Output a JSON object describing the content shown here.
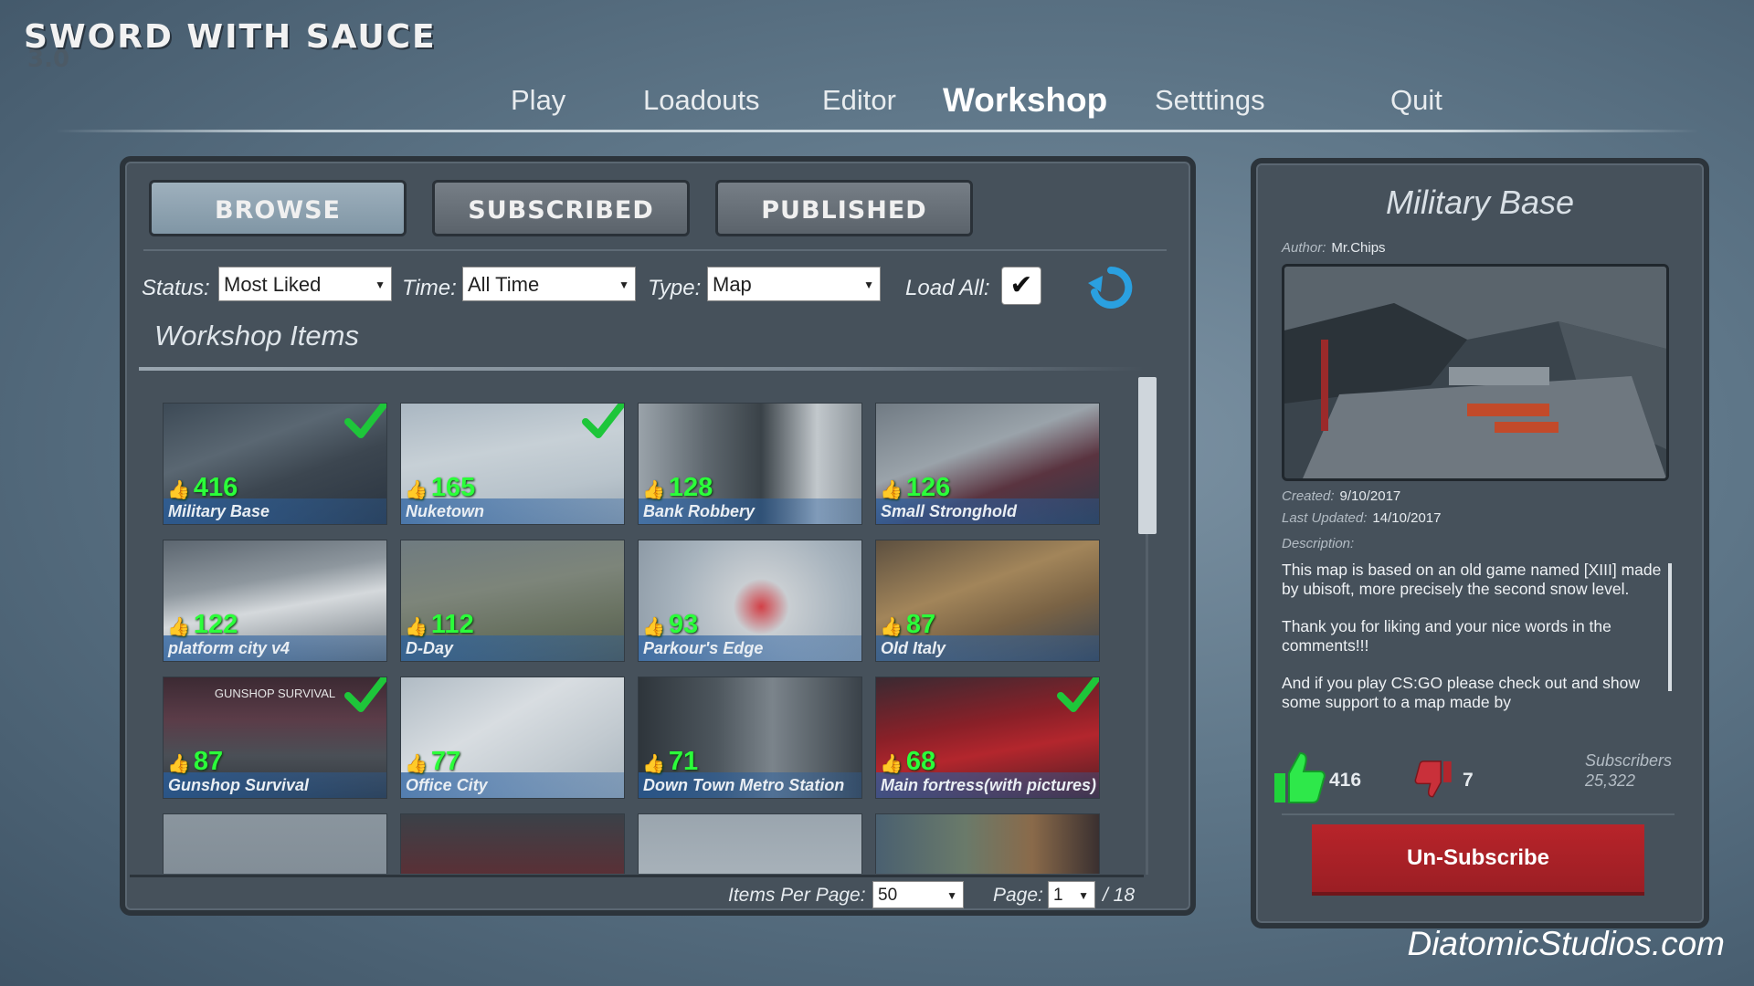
{
  "game": {
    "title": "SWORD WITH SAUCE",
    "version": "3.0"
  },
  "nav": {
    "items": [
      "Play",
      "Loadouts",
      "Editor",
      "Workshop",
      "Setttings",
      "Quit"
    ],
    "active": "Workshop"
  },
  "tabs": {
    "browse": "BROWSE",
    "subscribed": "SUBSCRIBED",
    "published": "PUBLISHED",
    "active": "BROWSE"
  },
  "filters": {
    "status_label": "Status:",
    "status_value": "Most Liked",
    "time_label": "Time:",
    "time_value": "All Time",
    "type_label": "Type:",
    "type_value": "Map",
    "load_all_label": "Load All:",
    "load_all_checked": true,
    "refresh_icon": "refresh-icon"
  },
  "workshop": {
    "title": "Workshop Items",
    "items": [
      {
        "name": "Military Base",
        "likes": "416",
        "subscribed": true
      },
      {
        "name": "Nuketown",
        "likes": "165",
        "subscribed": true
      },
      {
        "name": "Bank Robbery",
        "likes": "128",
        "subscribed": false
      },
      {
        "name": "Small Stronghold",
        "likes": "126",
        "subscribed": false
      },
      {
        "name": "platform city v4",
        "likes": "122",
        "subscribed": false
      },
      {
        "name": "D-Day",
        "likes": "112",
        "subscribed": false
      },
      {
        "name": "Parkour's Edge",
        "likes": "93",
        "subscribed": false
      },
      {
        "name": "Old Italy",
        "likes": "87",
        "subscribed": false
      },
      {
        "name": "Gunshop Survival",
        "likes": "87",
        "subscribed": true,
        "banner": "GUNSHOP SURVIVAL"
      },
      {
        "name": "Office City",
        "likes": "77",
        "subscribed": false
      },
      {
        "name": "Down Town Metro Station",
        "likes": "71",
        "subscribed": false
      },
      {
        "name": "Main fortress(with pictures)",
        "likes": "68",
        "subscribed": true
      }
    ],
    "like_icon": "thumbs-up-icon",
    "subscribed_icon": "checkmark-icon"
  },
  "pager": {
    "items_per_page_label": "Items Per Page:",
    "items_per_page": "50",
    "page_label": "Page:",
    "page": "1",
    "total_pages": "/ 18"
  },
  "detail": {
    "title": "Military Base",
    "author_label": "Author:",
    "author": "Mr.Chips",
    "created_label": "Created:",
    "created": "9/10/2017",
    "updated_label": "Last Updated:",
    "updated": "14/10/2017",
    "description_label": "Description:",
    "description": [
      "This map is based on an old game named [XIII] made by ubisoft, more precisely the second snow level.",
      "Thank you for liking and your nice words in the comments!!!",
      "And if you play CS:GO please check out and show some support to a map made by"
    ],
    "likes": "416",
    "dislikes": "7",
    "subscribers_label": "Subscribers",
    "subscribers": "25,322",
    "unsubscribe_label": "Un-Subscribe"
  },
  "footer": "DiatomicStudios.com",
  "colors": {
    "like_green": "#2bff3a",
    "unsubscribe_red": "#b8242a",
    "active_tab": "#8ea2b1"
  }
}
